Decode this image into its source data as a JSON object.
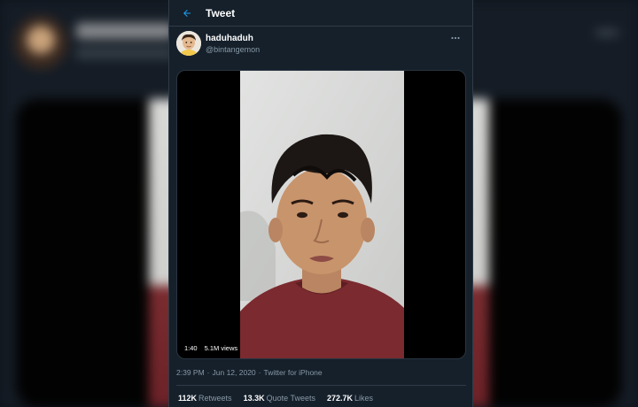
{
  "colors": {
    "accent": "#1da1f2",
    "background": "#15202b",
    "border": "#2f3b47",
    "secondary_text": "#8899a6",
    "primary_text": "#ffffff"
  },
  "header": {
    "back_icon": "arrow-left-icon",
    "title": "Tweet"
  },
  "author": {
    "name": "haduhaduh",
    "handle": "@bintangemon",
    "more_icon": "more-horizontal-icon"
  },
  "video": {
    "duration": "1:40",
    "views": "5.1M views"
  },
  "meta": {
    "time": "2:39 PM",
    "separator1": "·",
    "date": "Jun 12, 2020",
    "separator2": "·",
    "source": "Twitter for iPhone"
  },
  "stats": {
    "retweets_count": "112K",
    "retweets_label": "Retweets",
    "quotes_count": "13.3K",
    "quotes_label": "Quote Tweets",
    "likes_count": "272.7K",
    "likes_label": "Likes"
  }
}
